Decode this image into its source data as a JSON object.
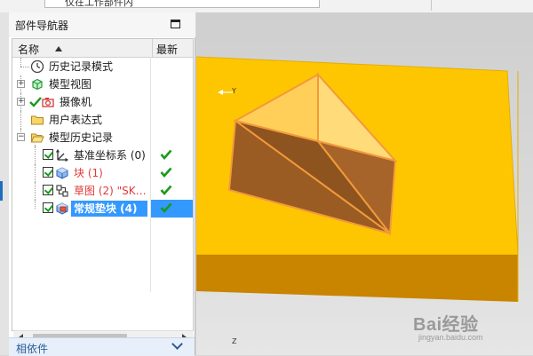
{
  "toolbar": {
    "combo_text": "仅在工作部件内"
  },
  "panel": {
    "title": "部件导航器",
    "columns": {
      "name": "名称",
      "latest": "最新"
    }
  },
  "tree": [
    {
      "label": "历史记录模式",
      "icon": "clock-icon",
      "red": false
    },
    {
      "label": "模型视图",
      "icon": "model-views-icon",
      "red": false
    },
    {
      "label": "摄像机",
      "icon": "camera-icon",
      "red": false
    },
    {
      "label": "用户表达式",
      "icon": "folder-icon",
      "red": false
    },
    {
      "label": "模型历史记录",
      "icon": "open-folder-icon",
      "red": false
    },
    {
      "label": "基准坐标系 (0)",
      "icon": "datum-csys-icon",
      "red": false
    },
    {
      "label": "块 (1)",
      "icon": "block-icon",
      "red": true
    },
    {
      "label": "草图 (2) \"SK…",
      "icon": "sketch-icon",
      "red": true
    },
    {
      "label": "常规垫块 (4)",
      "icon": "pad-icon",
      "red": false
    }
  ],
  "dependencies": {
    "label": "相依件"
  },
  "viewport": {
    "axis_y": "Y",
    "axis_z": "Z"
  },
  "watermark": {
    "brand": "Bai经验",
    "url": "jingyan.baidu.com"
  },
  "colors": {
    "block_top": "#fec600",
    "block_front": "#c98400",
    "pad_top": "#ffd45e",
    "pad_side": "#9a5a1a",
    "edge": "#f29a3a",
    "selection": "#3399ff",
    "check_green": "#1a9a1a"
  }
}
